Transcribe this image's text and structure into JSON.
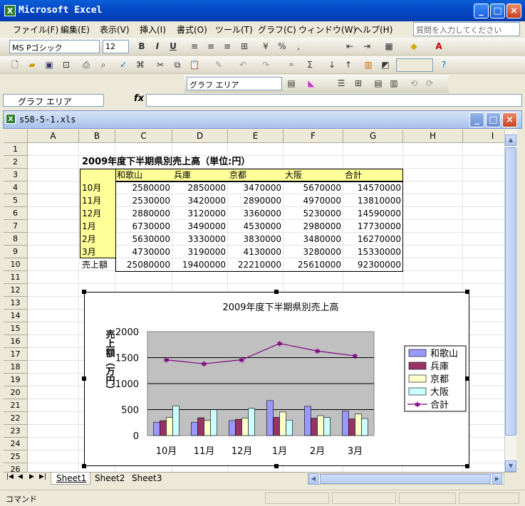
{
  "app": {
    "title": "Microsoft Excel",
    "icon": "excel-icon"
  },
  "menu": [
    "ファイル(F)",
    "編集(E)",
    "表示(V)",
    "挿入(I)",
    "書式(O)",
    "ツール(T)",
    "グラフ(C)",
    "ウィンドウ(W)",
    "ヘルプ(H)"
  ],
  "help_placeholder": "質問を入力してください",
  "format_bar": {
    "font": "MS Pゴシック",
    "size": "12"
  },
  "chart_toolbar": {
    "object": "グラフ エリア"
  },
  "namebox": "グラフ エリア",
  "fx": "fx",
  "workbook": {
    "title": "s58-5-1.xls"
  },
  "columns": [
    "A",
    "B",
    "C",
    "D",
    "E",
    "F",
    "G",
    "H",
    "I"
  ],
  "rows": [
    "1",
    "2",
    "3",
    "4",
    "5",
    "6",
    "7",
    "8",
    "9",
    "10",
    "11",
    "12",
    "13",
    "14",
    "15",
    "16",
    "17",
    "18",
    "19",
    "20",
    "21",
    "22",
    "23",
    "24",
    "25",
    "26"
  ],
  "sheet_title": "2009年度下半期県別売上高（単位:円）",
  "table": {
    "headers": [
      "和歌山",
      "兵庫",
      "京都",
      "大阪",
      "合計"
    ],
    "rows": [
      {
        "label": "10月",
        "values": [
          "2580000",
          "2850000",
          "3470000",
          "5670000",
          "14570000"
        ]
      },
      {
        "label": "11月",
        "values": [
          "2530000",
          "3420000",
          "2890000",
          "4970000",
          "13810000"
        ]
      },
      {
        "label": "12月",
        "values": [
          "2880000",
          "3120000",
          "3360000",
          "5230000",
          "14590000"
        ]
      },
      {
        "label": "1月",
        "values": [
          "6730000",
          "3490000",
          "4530000",
          "2980000",
          "17730000"
        ]
      },
      {
        "label": "2月",
        "values": [
          "5630000",
          "3330000",
          "3830000",
          "3480000",
          "16270000"
        ]
      },
      {
        "label": "3月",
        "values": [
          "4730000",
          "3190000",
          "4130000",
          "3280000",
          "15330000"
        ]
      }
    ],
    "total": {
      "label": "売上額",
      "values": [
        "25080000",
        "19400000",
        "22210000",
        "25610000",
        "92300000"
      ]
    }
  },
  "chart_data": {
    "type": "bar",
    "title": "2009年度下半期県別売上高",
    "ylabel": "売上額（万円）",
    "categories": [
      "10月",
      "11月",
      "12月",
      "1月",
      "2月",
      "3月"
    ],
    "ylim": [
      0,
      2000
    ],
    "yticks": [
      "0",
      "500",
      "1000",
      "1500",
      "2000"
    ],
    "series": [
      {
        "name": "和歌山",
        "type": "bar",
        "color": "#9999ff",
        "values": [
          258,
          253,
          288,
          673,
          563,
          473
        ]
      },
      {
        "name": "兵庫",
        "type": "bar",
        "color": "#993366",
        "values": [
          285,
          342,
          312,
          349,
          333,
          319
        ]
      },
      {
        "name": "京都",
        "type": "bar",
        "color": "#ffffcc",
        "values": [
          347,
          289,
          336,
          453,
          383,
          413
        ]
      },
      {
        "name": "大阪",
        "type": "bar",
        "color": "#ccffff",
        "values": [
          567,
          497,
          523,
          298,
          348,
          328
        ]
      },
      {
        "name": "合計",
        "type": "line",
        "color": "#800080",
        "values": [
          1457,
          1381,
          1459,
          1773,
          1627,
          1533
        ]
      }
    ],
    "legend": "right",
    "grid": true
  },
  "sheets": [
    "Sheet1",
    "Sheet2",
    "Sheet3"
  ],
  "status": "コマンド"
}
